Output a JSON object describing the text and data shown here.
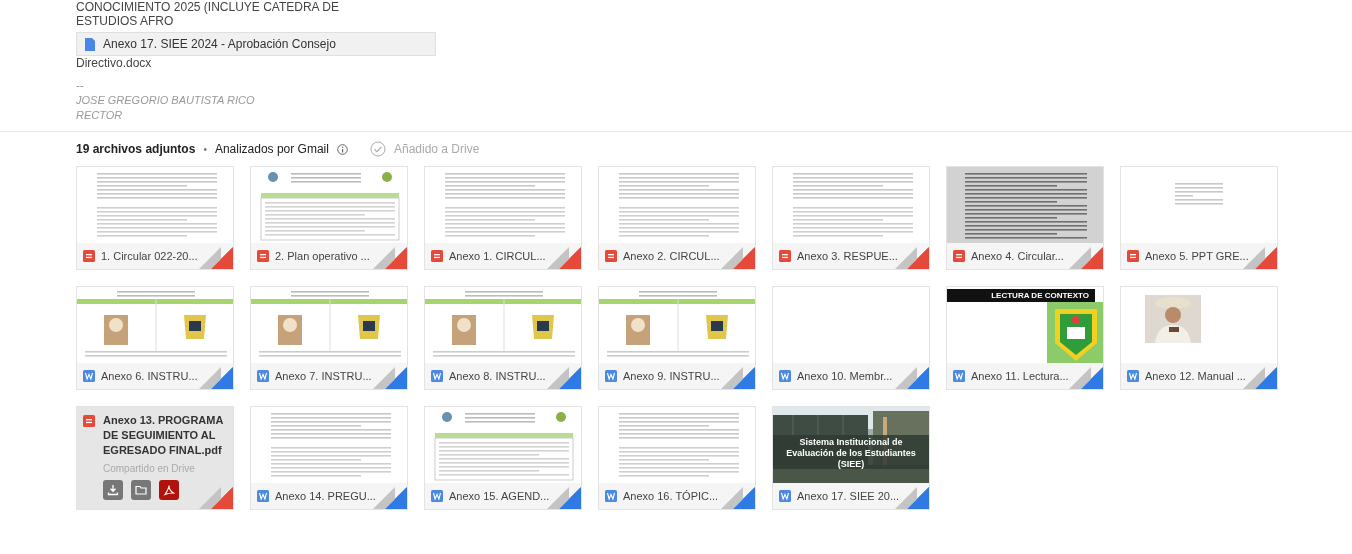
{
  "quoted_lines": [
    "CONOCIMIENTO 2025 (INCLUYE CATEDRA DE",
    "ESTUDIOS AFRO"
  ],
  "inline_attachment": {
    "name": "Anexo 17. SIEE 2024 - Aprobación Consejo",
    "name_continued": "Directivo.docx"
  },
  "signature": {
    "separator": "--",
    "name": "JOSE GREGORIO BAUTISTA RICO",
    "role": "RECTOR"
  },
  "attachments_header": {
    "count": "19 archivos adjuntos",
    "bullet": "•",
    "scanned": "Analizados por Gmail",
    "drive": "Añadido a Drive"
  },
  "attachments": [
    {
      "name": "1. Circular 022-20...",
      "kind": "pdf",
      "hovered": false
    },
    {
      "name": "2. Plan operativo ...",
      "kind": "pdf",
      "hovered": false
    },
    {
      "name": "Anexo 1. CIRCUL...",
      "kind": "pdf",
      "hovered": false
    },
    {
      "name": "Anexo 2. CIRCUL...",
      "kind": "pdf",
      "hovered": false
    },
    {
      "name": "Anexo 3. RESPUE...",
      "kind": "pdf",
      "hovered": false
    },
    {
      "name": "Anexo 4. Circular...",
      "kind": "pdf",
      "hovered": false
    },
    {
      "name": "Anexo 5. PPT GRE...",
      "kind": "pdf",
      "hovered": false
    },
    {
      "name": "Anexo 6. INSTRU...",
      "kind": "word",
      "hovered": false
    },
    {
      "name": "Anexo 7. INSTRU...",
      "kind": "word",
      "hovered": false
    },
    {
      "name": "Anexo 8. INSTRU...",
      "kind": "word",
      "hovered": false
    },
    {
      "name": "Anexo 9. INSTRU...",
      "kind": "word",
      "hovered": false
    },
    {
      "name": "Anexo 10. Membr...",
      "kind": "word",
      "hovered": false
    },
    {
      "name": "Anexo 11. Lectura...",
      "kind": "word",
      "caption": "LECTURA DE CONTEXTO",
      "hovered": false
    },
    {
      "name": "Anexo 12. Manual ...",
      "kind": "word",
      "hovered": false
    },
    {
      "name": "Anexo 13. PROGRAMA DE SEGUIMIENTO AL EGRESADO FINAL.pdf",
      "kind": "pdf",
      "hovered": true,
      "status": "Compartido en Drive"
    },
    {
      "name": "Anexo 14. PREGU...",
      "kind": "word",
      "hovered": false
    },
    {
      "name": "Anexo 15. AGEND...",
      "kind": "word",
      "hovered": false
    },
    {
      "name": "Anexo 16. TÓPIC...",
      "kind": "word",
      "hovered": false
    },
    {
      "name": "Anexo 17. SIEE 20...",
      "kind": "word",
      "caption": "Sistema Institucional de Evaluación de los Estudiantes (SIEE)",
      "hovered": false
    }
  ]
}
